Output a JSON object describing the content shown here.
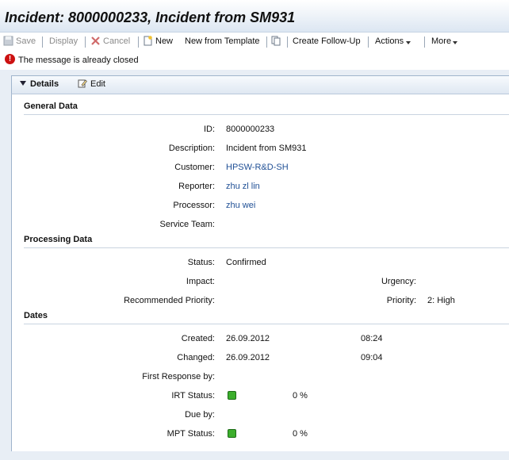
{
  "title": "Incident: 8000000233, Incident from SM931",
  "toolbar": {
    "save": "Save",
    "display": "Display",
    "cancel": "Cancel",
    "new": "New",
    "new_from_template": "New from Template",
    "create_follow_up": "Create Follow-Up",
    "actions": "Actions",
    "more": "More"
  },
  "message": "The message is already closed",
  "panel": {
    "title": "Details",
    "edit": "Edit"
  },
  "general": {
    "heading": "General Data",
    "id_label": "ID:",
    "id": "8000000233",
    "description_label": "Description:",
    "description": "Incident from SM931",
    "customer_label": "Customer:",
    "customer": "HPSW-R&D-SH",
    "reporter_label": "Reporter:",
    "reporter": "zhu zl lin",
    "processor_label": "Processor:",
    "processor": "zhu wei",
    "service_team_label": "Service Team:"
  },
  "processing": {
    "heading": "Processing Data",
    "status_label": "Status:",
    "status": "Confirmed",
    "impact_label": "Impact:",
    "urgency_label": "Urgency:",
    "recommended_priority_label": "Recommended Priority:",
    "priority_label": "Priority:",
    "priority": "2: High"
  },
  "dates": {
    "heading": "Dates",
    "created_label": "Created:",
    "created_date": "26.09.2012",
    "created_time": "08:24",
    "changed_label": "Changed:",
    "changed_date": "26.09.2012",
    "changed_time": "09:04",
    "first_response_label": "First Response by:",
    "irt_status_label": "IRT Status:",
    "irt_percent": "0 %",
    "due_by_label": "Due by:",
    "mpt_status_label": "MPT Status:",
    "mpt_percent": "0 %"
  },
  "colors": {
    "link": "#1f4f95",
    "status_ok": "#3cae2c",
    "error": "#cc1111"
  }
}
